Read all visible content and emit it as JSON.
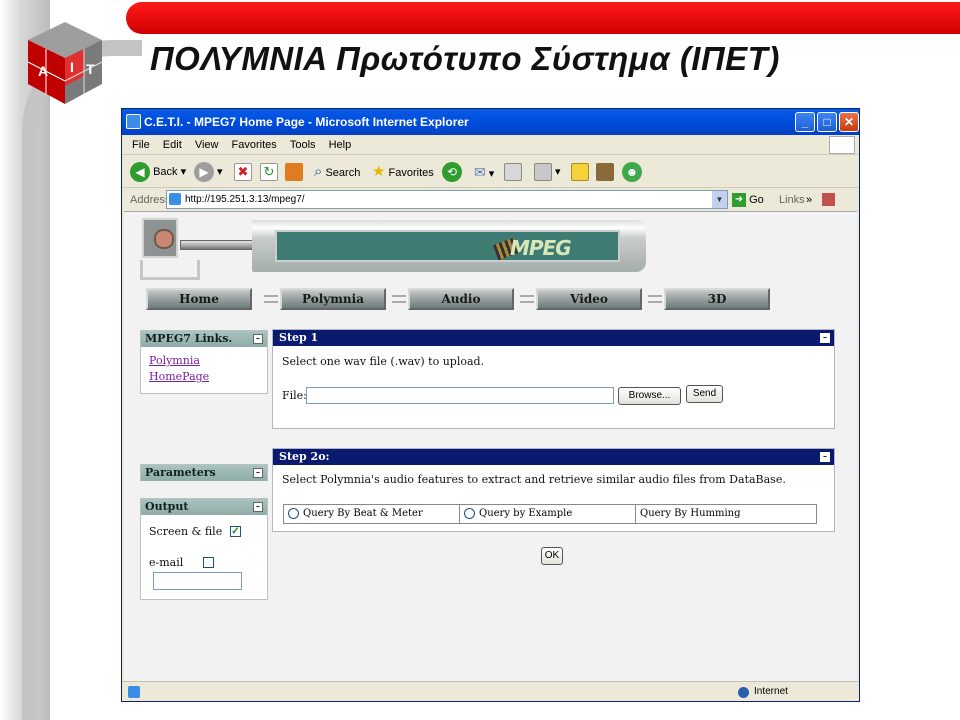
{
  "slide": {
    "title": "ΠΟΛΥΜΝΙΑ Πρωτότυπο Σύστημα (ΙΠΕΤ)",
    "logo_letters": [
      "A",
      "I",
      "T"
    ],
    "accent_red": "#e00000"
  },
  "window": {
    "title": "C.E.T.I. - MPEG7 Home Page - Microsoft Internet Explorer",
    "minimize_label": "_",
    "maximize_label": "□",
    "close_label": "✕"
  },
  "menu": {
    "items": [
      "File",
      "Edit",
      "View",
      "Favorites",
      "Tools",
      "Help"
    ]
  },
  "toolbar": {
    "back_label": "Back",
    "search_label": "Search",
    "favorites_label": "Favorites"
  },
  "address": {
    "label": "Address",
    "url": "http://195.251.3.13/mpeg7/",
    "go_label": "Go",
    "links_label": "Links",
    "chevron": "»"
  },
  "banner": {
    "logo_text": "MPEG"
  },
  "nav": {
    "items": [
      "Home",
      "Polymnia",
      "Audio",
      "Video",
      "3D"
    ]
  },
  "sidebar": {
    "links_title": "MPEG7 Links.",
    "links": [
      "Polymnia",
      "HomePage"
    ],
    "parameters_title": "Parameters",
    "output_title": "Output",
    "screen_file_label": "Screen & file",
    "screen_file_checked": true,
    "email_label": "e-mail",
    "email_checked": false,
    "email_value": ""
  },
  "step1": {
    "title": "Step 1",
    "instruction": "Select one wav file (.wav) to upload.",
    "file_label": "File:",
    "file_value": "",
    "browse_label": "Browse...",
    "send_label": "Send"
  },
  "step2": {
    "title": "Step 2o:",
    "instruction": "Select Polymnia's audio features to extract and retrieve similar audio files from DataBase.",
    "options": [
      "Query By Beat & Meter",
      "Query by Example",
      "Query By Humming"
    ],
    "ok_label": "OK"
  },
  "status": {
    "zone": "Internet"
  }
}
